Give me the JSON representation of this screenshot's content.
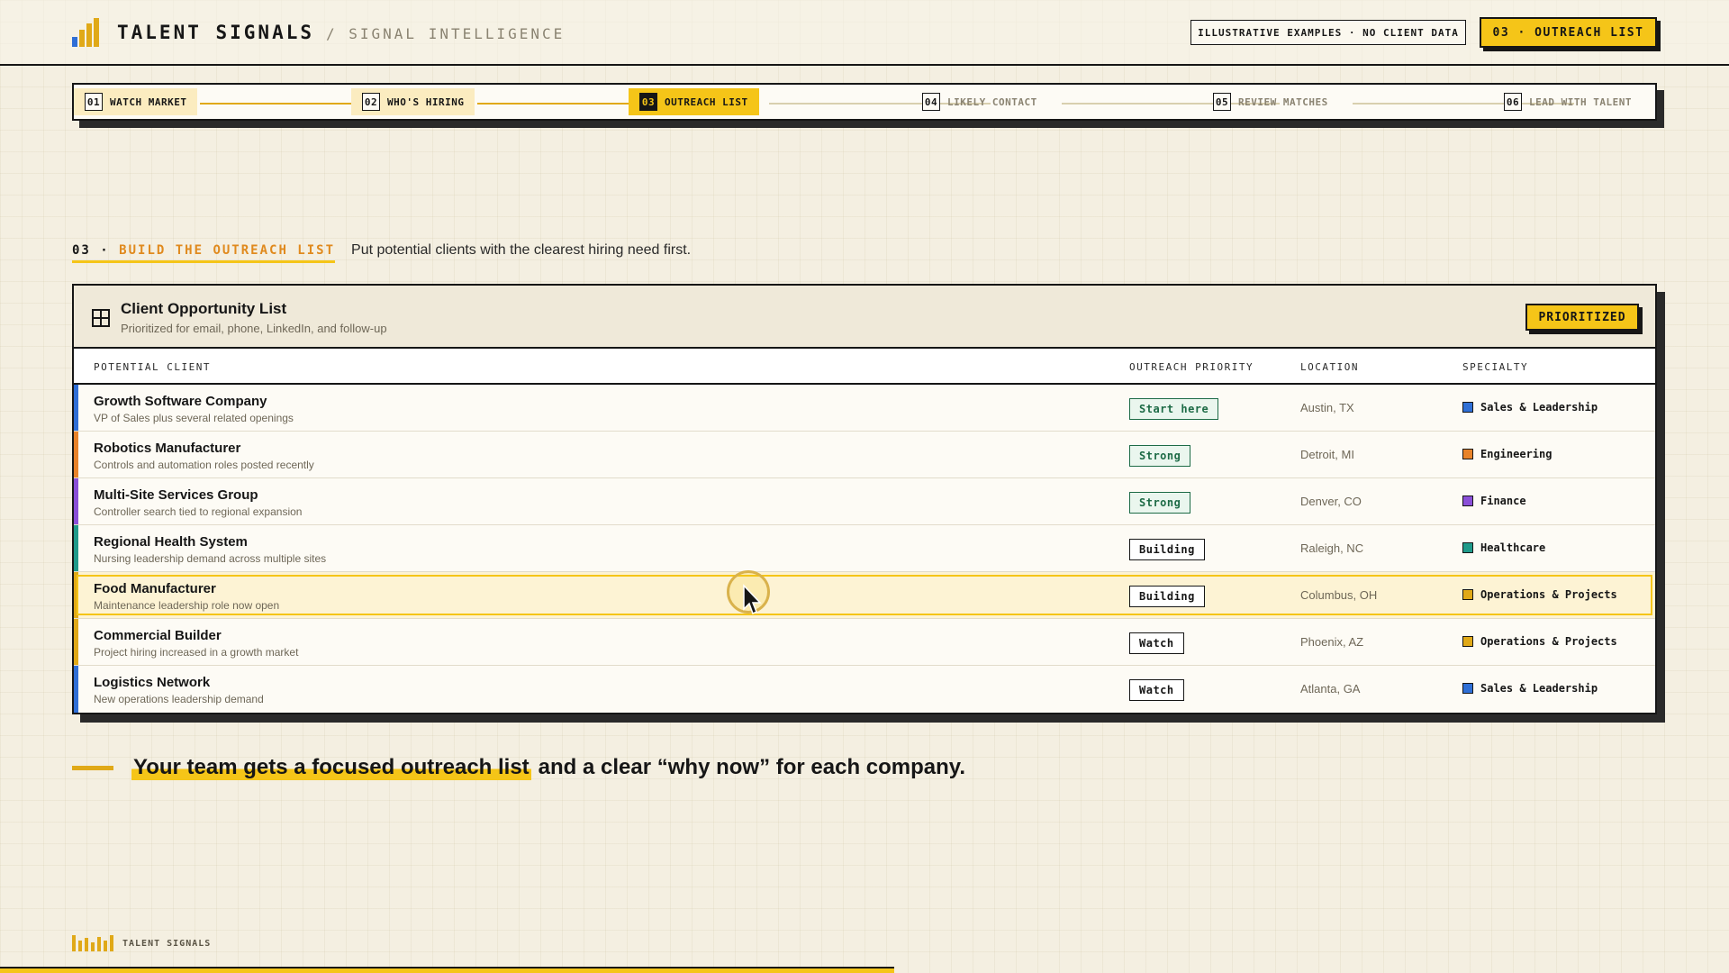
{
  "header": {
    "brand": "TALENT SIGNALS",
    "subbrand": "/ SIGNAL INTELLIGENCE",
    "disclaimer": "ILLUSTRATIVE EXAMPLES · NO CLIENT DATA",
    "cta": "03 · OUTREACH LIST",
    "logo_colors": [
      "#2f6fd6",
      "#e0a918",
      "#e0a918",
      "#e0a918"
    ]
  },
  "stepper": {
    "steps": [
      {
        "num": "01",
        "label": "WATCH MARKET",
        "state": "done"
      },
      {
        "num": "02",
        "label": "WHO'S HIRING",
        "state": "done"
      },
      {
        "num": "03",
        "label": "OUTREACH LIST",
        "state": "active"
      },
      {
        "num": "04",
        "label": "LIKELY CONTACT",
        "state": "todo"
      },
      {
        "num": "05",
        "label": "REVIEW MATCHES",
        "state": "todo"
      },
      {
        "num": "06",
        "label": "LEAD WITH TALENT",
        "state": "todo"
      }
    ]
  },
  "section": {
    "index": "03 ·",
    "title": "BUILD THE OUTREACH LIST",
    "description": "Put potential clients with the clearest hiring need first."
  },
  "table": {
    "title": "Client Opportunity List",
    "subtitle": "Prioritized for email, phone, LinkedIn, and follow-up",
    "badge": "PRIORITIZED",
    "columns": [
      "POTENTIAL CLIENT",
      "OUTREACH PRIORITY",
      "LOCATION",
      "SPECIALTY"
    ],
    "rows": [
      {
        "name": "Growth Software Company",
        "note": "VP of Sales plus several related openings",
        "priority": "Start here",
        "priority_style": "green",
        "location": "Austin, TX",
        "specialty": "Sales & Leadership",
        "color": "#2f6fd6"
      },
      {
        "name": "Robotics Manufacturer",
        "note": "Controls and automation roles posted recently",
        "priority": "Strong",
        "priority_style": "green",
        "location": "Detroit, MI",
        "specialty": "Engineering",
        "color": "#e8832a"
      },
      {
        "name": "Multi-Site Services Group",
        "note": "Controller search tied to regional expansion",
        "priority": "Strong",
        "priority_style": "green",
        "location": "Denver, CO",
        "specialty": "Finance",
        "color": "#8a4fd8"
      },
      {
        "name": "Regional Health System",
        "note": "Nursing leadership demand across multiple sites",
        "priority": "Building",
        "priority_style": "plain",
        "location": "Raleigh, NC",
        "specialty": "Healthcare",
        "color": "#1f9a8a"
      },
      {
        "name": "Food Manufacturer",
        "note": "Maintenance leadership role now open",
        "priority": "Building",
        "priority_style": "plain",
        "location": "Columbus, OH",
        "specialty": "Operations & Projects",
        "color": "#e0a918"
      },
      {
        "name": "Commercial Builder",
        "note": "Project hiring increased in a growth market",
        "priority": "Watch",
        "priority_style": "plain",
        "location": "Phoenix, AZ",
        "specialty": "Operations & Projects",
        "color": "#e0a918"
      },
      {
        "name": "Logistics Network",
        "note": "New operations leadership demand",
        "priority": "Watch",
        "priority_style": "plain",
        "location": "Atlanta, GA",
        "specialty": "Sales & Leadership",
        "color": "#2f6fd6"
      }
    ],
    "highlighted_row": 4
  },
  "takeaway": {
    "highlight": "Your team gets a focused outreach list",
    "rest": "and a clear “why now” for each company."
  },
  "footer": {
    "brand": "TALENT SIGNALS"
  },
  "colors": {
    "accent": "#f5c518",
    "orange": "#e08a1e",
    "ink": "#161616"
  }
}
